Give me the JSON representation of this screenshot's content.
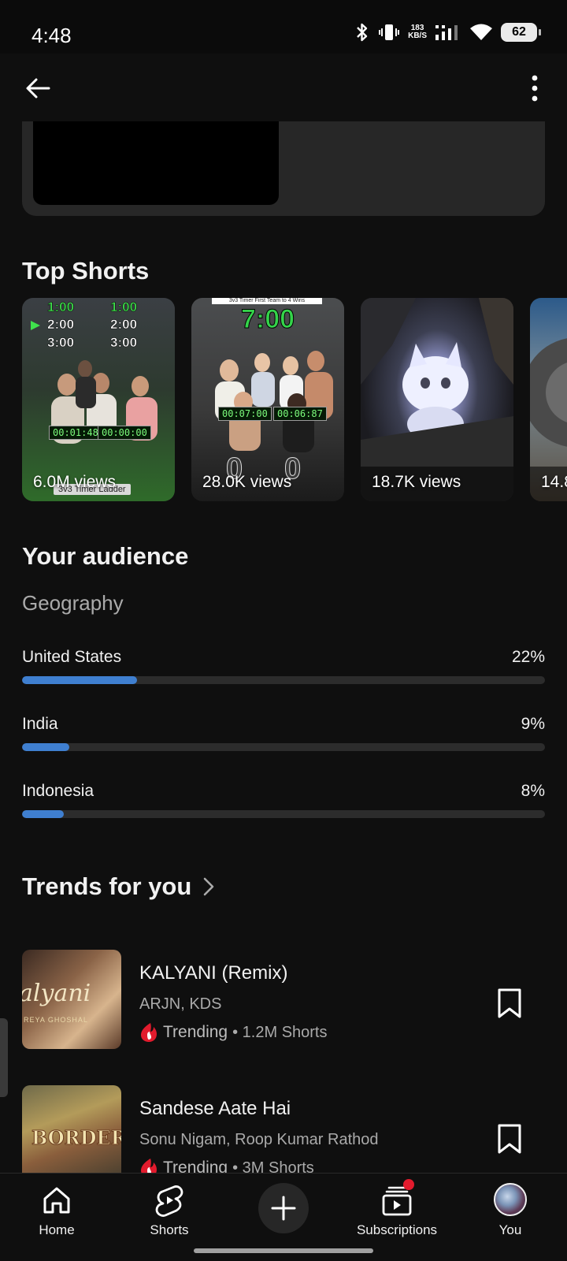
{
  "status_bar": {
    "time": "4:48",
    "network_speed_value": "183",
    "network_speed_unit": "KB/S",
    "battery": "62"
  },
  "partial_card": {},
  "top_shorts": {
    "title": "Top Shorts",
    "items": [
      {
        "views": "6.0M views",
        "overlay_lines": [
          "1:00",
          "2:00",
          "3:00"
        ],
        "lcd_left": "00:01:48",
        "lcd_right": "00:00:00",
        "caption": "3v3 Timer Ladder"
      },
      {
        "views": "28.0K views",
        "big_time": "7:00",
        "banner": "3v3 Timer First Team to 4 Wins",
        "lcd_left": "00:07:00",
        "lcd_right": "00:06:87",
        "score": [
          "0",
          "0"
        ]
      },
      {
        "views": "18.7K views"
      },
      {
        "views": "14.8"
      }
    ]
  },
  "audience": {
    "title": "Your audience",
    "subtitle": "Geography",
    "rows": [
      {
        "country": "United States",
        "percent_label": "22%",
        "percent": 22
      },
      {
        "country": "India",
        "percent_label": "9%",
        "percent": 9
      },
      {
        "country": "Indonesia",
        "percent_label": "8%",
        "percent": 8
      }
    ]
  },
  "trends": {
    "title": "Trends for you",
    "items": [
      {
        "name": "KALYANI (Remix)",
        "artists": "ARJN, KDS",
        "trending_label": "Trending",
        "meta": "• 1.2M Shorts",
        "art_text": "alyani",
        "art_subtext": "REYA GHOSHAL"
      },
      {
        "name": "Sandese Aate Hai",
        "artists": "Sonu Nigam, Roop Kumar Rathod",
        "trending_label": "Trending",
        "meta": "• 3M Shorts",
        "art_text": "BORDER"
      }
    ]
  },
  "bottom_nav": {
    "items": [
      {
        "label": "Home"
      },
      {
        "label": "Shorts"
      },
      {
        "label": "Subscriptions"
      },
      {
        "label": "You"
      }
    ]
  },
  "colors": {
    "background": "#0f0f0f",
    "progress_fill": "#3f7fd0",
    "progress_track": "#2c2c2c",
    "notification_dot": "#e21b2d",
    "trending_icon": "#e21b2d"
  },
  "icons": [
    "back-arrow-icon",
    "more-vertical-icon",
    "bookmark-icon",
    "chevron-right-icon",
    "trending-icon",
    "home-icon",
    "shorts-icon",
    "plus-icon",
    "subscriptions-icon",
    "bluetooth-icon",
    "vibrate-icon",
    "signal-icon",
    "wifi-icon",
    "battery-icon"
  ]
}
